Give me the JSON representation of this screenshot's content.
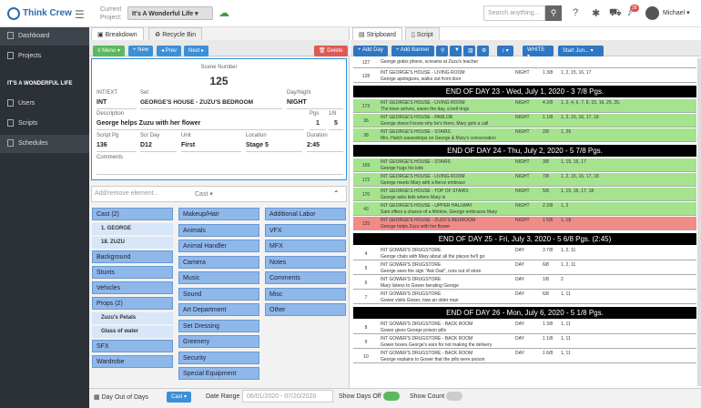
{
  "app": {
    "name": "Think Crew",
    "current_project_label": "Current Project:",
    "project": "It's A Wonderful Life",
    "search_placeholder": "Search anything...",
    "badge": "28",
    "user": "Michael"
  },
  "sidebar": {
    "items": [
      "Dashboard",
      "Projects"
    ],
    "section": "IT'S A WONDERFUL LIFE",
    "sub_items": [
      "Users",
      "Scripts",
      "Schedules"
    ]
  },
  "mid": {
    "tab_breakdown": "Breakdown",
    "tab_recycle": "Recycle Bin",
    "menu": "Menu",
    "new": "New",
    "prev": "Prev",
    "next": "Next",
    "delete": "Delete"
  },
  "scene": {
    "number_label": "Scene Number",
    "number": "125",
    "intext_label": "INT/EXT",
    "intext": "INT",
    "set_label": "Set",
    "set": "GEORGE'S HOUSE - ZUZU'S BEDROOM",
    "daynight_label": "Day/Night",
    "daynight": "NIGHT",
    "desc_label": "Description",
    "desc": "George helps Zuzu with her flower",
    "pgs_label": "Pgs",
    "pgs": "1",
    "eighths_label": "1/8",
    "eighths": "5",
    "scriptpg_label": "Script Pg",
    "scriptpg": "136",
    "scrday_label": "Scr Day",
    "scrday": "D12",
    "unit_label": "Unit",
    "unit": "First",
    "location_label": "Location",
    "location": "Stage 5",
    "duration_label": "Duration",
    "duration": "2:45",
    "comments_label": "Comments"
  },
  "elements": {
    "add_placeholder": "Add/remove element...",
    "cast_select": "Cast",
    "col1": [
      {
        "cat": "Cast (2)"
      },
      {
        "sub": "1. GEORGE"
      },
      {
        "sub": "18. ZUZU"
      },
      {
        "cat": "Background"
      },
      {
        "cat": "Stunts"
      },
      {
        "cat": "Vehicles"
      },
      {
        "cat": "Props (2)"
      },
      {
        "sub": "Zuzu's Petals"
      },
      {
        "sub": "Glass of water"
      },
      {
        "cat": "SFX"
      },
      {
        "cat": "Wardrobe"
      }
    ],
    "col2": [
      "Makeup/Hair",
      "Animals",
      "Animal Handler",
      "Camera",
      "Music",
      "Sound",
      "Art Department",
      "Set Dressing",
      "Greenery",
      "Security",
      "Special Equipment"
    ],
    "col3": [
      "Additional Labor",
      "VFX",
      "MFX",
      "Notes",
      "Comments",
      "Misc",
      "Other"
    ]
  },
  "right": {
    "tab_stripboard": "Stripboard",
    "tab_script": "Script",
    "add_day": "Add Day",
    "add_banner": "Add Banner",
    "white": "WHITE",
    "start": "Start Jun..."
  },
  "strips": [
    {
      "t": "w",
      "n": "127",
      "a": "George grabs phone, screams at Zuzu's teacher",
      "b": "",
      "c": "",
      "d": "",
      "e": ""
    },
    {
      "t": "w",
      "n": "128",
      "a": "INT     GEORGE'S HOUSE - LIVING ROOM",
      "b": "George apologizes, walks out front door",
      "c": "NIGHT",
      "d": "1 3/8",
      "e": "1, 2, 15, 16, 17"
    },
    {
      "t": "end",
      "a": "END OF DAY 23 - Wed, July 1, 2020 - 3 7/8 Pgs."
    },
    {
      "t": "g",
      "n": "173",
      "a": "INT     GEORGE'S HOUSE - LIVING ROOM",
      "b": "The town arrives, saves the day, a bell rings",
      "c": "NIGHT",
      "d": "4 2/8",
      "e": "1, 2, 4, 6, 7, 8, 15, 16, 25, 26,"
    },
    {
      "t": "g",
      "n": "36",
      "a": "INT     GEORGE'S HOUSE - PARLOR",
      "b": "George doesn't know why he's there, Mary gets a call",
      "c": "NIGHT",
      "d": "1 1/8",
      "e": "1, 2, 15, 16, 17, 18"
    },
    {
      "t": "g",
      "n": "38",
      "a": "INT     GEORGE'S HOUSE - STAIRS",
      "b": "Mrs. Hatch eavesdrops on George & Mary's conversation",
      "c": "NIGHT",
      "d": "2/8",
      "e": "1, 26"
    },
    {
      "t": "end",
      "a": "END OF DAY 24 - Thu, July 2, 2020 - 5 7/8 Pgs."
    },
    {
      "t": "g",
      "n": "169",
      "a": "INT     GEORGE'S HOUSE - STAIRS",
      "b": "George hugs his kids",
      "c": "NIGHT",
      "d": "3/8",
      "e": "1, 15, 16, 17"
    },
    {
      "t": "g",
      "n": "172",
      "a": "INT     GEORGE'S HOUSE - LIVING ROOM",
      "b": "George meets Mary with a fierce embrace",
      "c": "NIGHT",
      "d": "7/8",
      "e": "1, 2, 15, 16, 17, 18"
    },
    {
      "t": "g",
      "n": "170",
      "a": "INT     GEORGE'S HOUSE - TOP OF STAIRS",
      "b": "George asks kids where Mary is",
      "c": "NIGHT",
      "d": "5/8",
      "e": "1, 15, 16, 17, 18"
    },
    {
      "t": "g",
      "n": "43",
      "a": "INT     GEORGE'S HOUSE - UPPER HALLWAY",
      "b": "Sam offers a chance of a lifetime, George embraces Mary",
      "c": "NIGHT",
      "d": "2 2/8",
      "e": "1, 2"
    },
    {
      "t": "r",
      "n": "125",
      "a": "INT     GEORGE'S HOUSE - ZUZU'S BEDROOM",
      "b": "George helps Zuzu with her flower",
      "c": "NIGHT",
      "d": "1 5/8",
      "e": "1, 18"
    },
    {
      "t": "end",
      "a": "END OF DAY 25 - Fri, July 3, 2020 - 5 6/8 Pgs. (2:45)"
    },
    {
      "t": "w",
      "n": "4",
      "a": "INT     GOWER'S DRUGSTORE",
      "b": "George chats with Mary about all the places he'll go",
      "c": "DAY",
      "d": "3 7/8",
      "e": "1, 2, 11"
    },
    {
      "t": "w",
      "n": "5",
      "a": "INT     GOWER'S DRUGSTORE",
      "b": "George sees the sign \"Ask Dad\", runs out of store",
      "c": "DAY",
      "d": "6/8",
      "e": "1, 2, 11"
    },
    {
      "t": "w",
      "n": "6",
      "a": "INT     GOWER'S DRUGSTORE",
      "b": "Mary listens to Gower berating George",
      "c": "DAY",
      "d": "1/8",
      "e": "2"
    },
    {
      "t": "w",
      "n": "7",
      "a": "INT     GOWER'S DRUGSTORE",
      "b": "Gower visits Gower, now an older man",
      "c": "DAY",
      "d": "6/8",
      "e": "1, 11"
    },
    {
      "t": "end",
      "a": "END OF DAY 26 - Mon, July 6, 2020 - 5 1/8 Pgs."
    },
    {
      "t": "w",
      "n": "8",
      "a": "INT     GOWER'S DRUGSTORE - BACK ROOM",
      "b": "Gower gives George poison pills",
      "c": "DAY",
      "d": "1 3/8",
      "e": "1, 11"
    },
    {
      "t": "w",
      "n": "9",
      "a": "INT     GOWER'S DRUGSTORE - BACK ROOM",
      "b": "Gower boxes George's ears for not making the delivery",
      "c": "DAY",
      "d": "1 1/8",
      "e": "1, 11"
    },
    {
      "t": "w",
      "n": "10",
      "a": "INT     GOWER'S DRUGSTORE - BACK ROOM",
      "b": "George explains to Gower that the pills were poison",
      "c": "DAY",
      "d": "1 6/8",
      "e": "1, 11"
    }
  ],
  "bottom": {
    "dood": "Day Out of Days",
    "cast": "Cast",
    "range_label": "Date Range",
    "range": "06/01/2020  -  07/20/2020",
    "days_off": "Show Days Off",
    "show_count": "Show Count"
  }
}
